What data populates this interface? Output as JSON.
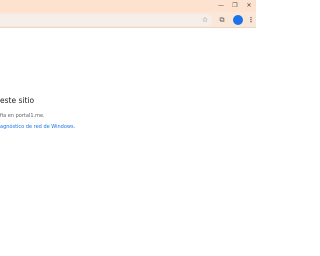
{
  "window": {
    "controls": {
      "minimize": "—",
      "restore": "❐",
      "close": "✕"
    }
  },
  "toolbar": {
    "bookmark_icon": "star-icon",
    "extensions_icon": "extensions-icon",
    "profile_initial": "",
    "menu_icon": "⋮"
  },
  "error_page": {
    "heading": "este sitio",
    "description": "fia en portal1.me.",
    "diagnostic_link": "agnóstico de red de Windows."
  },
  "colors": {
    "titlebar": "#fde3cf",
    "toolbar": "#fbe7d8",
    "link": "#1a73e8",
    "heading": "#202124",
    "body_text": "#5f6368"
  }
}
